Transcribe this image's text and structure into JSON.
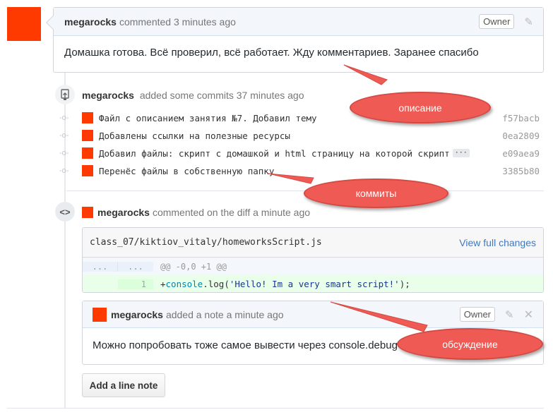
{
  "top_comment": {
    "author": "megarocks",
    "meta": "commented 3 minutes ago",
    "owner_badge": "Owner",
    "body": "Домашка готова. Всё проверил, всё работает. Жду комментариев. Заранее спасибо"
  },
  "commits_event": {
    "author": "megarocks",
    "meta": "added some commits 37 minutes ago",
    "commits": [
      {
        "message": "Файл с описанием занятия №7. Добавил тему",
        "sha": "f57bacb"
      },
      {
        "message": "Добавлены ссылки на полезные ресурсы",
        "sha": "0ea2809"
      },
      {
        "message": "Добавил файлы: скрипт с домашкой и html страницу на которой скрипт",
        "sha": "e09aea9",
        "ellipsis": "···"
      },
      {
        "message": "Перенёс файлы в собственную папку",
        "sha": "3385b80"
      }
    ]
  },
  "diff_event": {
    "author": "megarocks",
    "meta": "commented on the diff a minute ago",
    "file_path": "class_07/kiktiov_vitaly/homeworksScript.js",
    "view_link": "View full changes",
    "hunk": {
      "left": "...",
      "right": "...",
      "header": "@@ -0,0 +1 @@"
    },
    "added_line": {
      "num": "1",
      "prefix": "+",
      "obj": "console",
      "dot": ".",
      "fn": "log",
      "open": "(",
      "str": "'Hello! Im a very smart script!'",
      "close": ");"
    }
  },
  "note": {
    "author": "megarocks",
    "meta": "added a note a minute ago",
    "owner_badge": "Owner",
    "body": "Можно попробовать тоже самое вывести через console.debug"
  },
  "add_note_button": "Add a line note",
  "annotations": {
    "description": "описание",
    "commits": "коммиты",
    "discussion": "обсуждение"
  },
  "icons": {
    "commit_event": "repo-push-icon",
    "diff_event": "code-icon",
    "edit": "pencil-icon",
    "close": "x-icon"
  },
  "colors": {
    "avatar": "#ff3a00",
    "annotation_bubble": "#ef5b54",
    "link": "#4078c0",
    "addition_bg": "#eaffea"
  }
}
